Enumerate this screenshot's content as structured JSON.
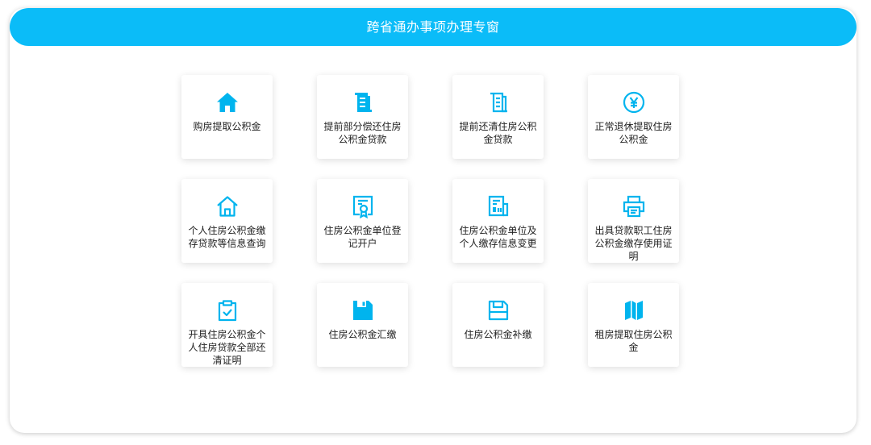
{
  "header": {
    "title": "跨省通办事项办理专窗"
  },
  "colors": {
    "accent": "#0bbcf8",
    "icon": "#00b4ee"
  },
  "items": [
    {
      "label": "购房提取公积金",
      "icon": "house-filled-icon"
    },
    {
      "label": "提前部分偿还住房公积金贷款",
      "icon": "scroll-document-icon"
    },
    {
      "label": "提前还清住房公积金贷款",
      "icon": "scroll-document-outline-icon"
    },
    {
      "label": "正常退休提取住房公积金",
      "icon": "yuan-circle-icon"
    },
    {
      "label": "个人住房公积金缴存贷款等信息查询",
      "icon": "house-outline-icon"
    },
    {
      "label": "住房公积金单位登记开户",
      "icon": "certificate-icon"
    },
    {
      "label": "住房公积金单位及个人缴存信息变更",
      "icon": "newspaper-icon"
    },
    {
      "label": "出具贷款职工住房公积金缴存使用证明",
      "icon": "printer-icon"
    },
    {
      "label": "开具住房公积金个人住房贷款全部还清证明",
      "icon": "clipboard-check-icon"
    },
    {
      "label": "住房公积金汇缴",
      "icon": "floppy-filled-icon"
    },
    {
      "label": "住房公积金补缴",
      "icon": "floppy-outline-icon"
    },
    {
      "label": "租房提取住房公积金",
      "icon": "map-icon"
    }
  ]
}
